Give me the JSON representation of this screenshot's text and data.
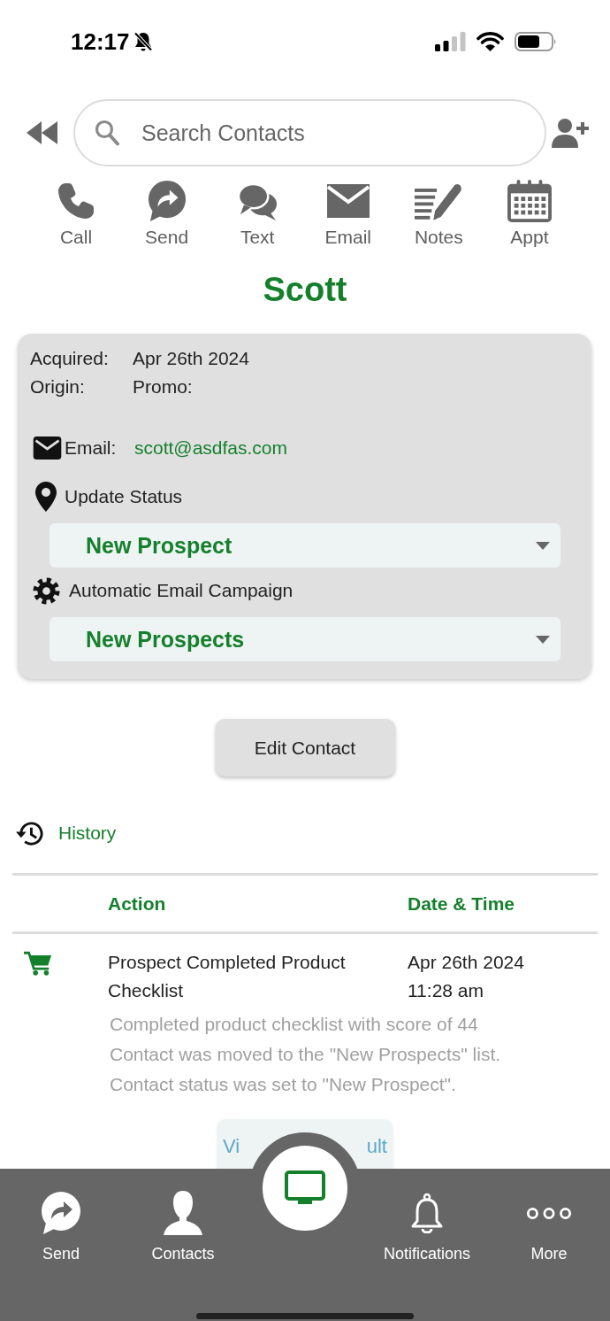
{
  "status_bar": {
    "time": "12:17"
  },
  "search": {
    "placeholder": "Search Contacts"
  },
  "actions": [
    {
      "kind": "phone",
      "label": "Call"
    },
    {
      "kind": "share",
      "label": "Send"
    },
    {
      "kind": "chat",
      "label": "Text"
    },
    {
      "kind": "mail",
      "label": "Email"
    },
    {
      "kind": "notes",
      "label": "Notes"
    },
    {
      "kind": "calendar",
      "label": "Appt"
    }
  ],
  "contact": {
    "name": "Scott"
  },
  "details": {
    "fields": [
      {
        "label": "Acquired:",
        "value": "Apr 26th 2024"
      },
      {
        "label": "Origin:",
        "value": "Promo:"
      }
    ],
    "email": {
      "label": "Email:",
      "value": "scott@asdfas.com"
    },
    "status": {
      "label": "Update Status",
      "value": "New Prospect"
    },
    "campaign": {
      "label": "Automatic Email Campaign",
      "value": "New Prospects"
    }
  },
  "edit_button": {
    "label": "Edit Contact"
  },
  "history": {
    "title": "History",
    "columns": [
      "Action",
      "Date & Time"
    ],
    "rows": [
      {
        "kind": "cart",
        "action": "Prospect Completed Product Checklist",
        "date": "Apr 26th 2024",
        "time": "11:28 am",
        "notes": [
          "Completed product checklist with score of 44",
          "Contact was moved to the \"New Prospects\" list.",
          "Contact status was set to \"New Prospect\"."
        ]
      }
    ],
    "view_result": {
      "label_parts": [
        "Vi",
        "ult"
      ]
    }
  },
  "bottom_nav": [
    {
      "kind": "share",
      "label": "Send"
    },
    {
      "kind": "person",
      "label": "Contacts"
    },
    {
      "kind": "monitor"
    },
    {
      "kind": "bell",
      "label": "Notifications"
    },
    {
      "kind": "dots",
      "label": "More"
    }
  ]
}
